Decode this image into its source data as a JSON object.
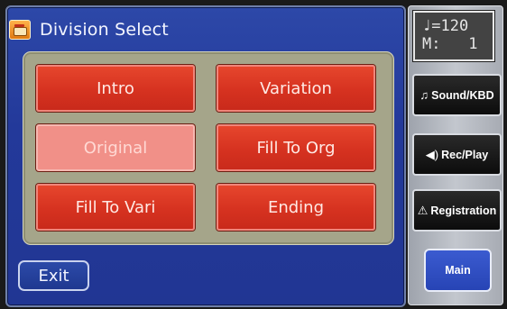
{
  "screen": {
    "title": "Division Select",
    "title_icon": "drum-icon"
  },
  "divisions": [
    {
      "label": "Intro",
      "selected": false
    },
    {
      "label": "Variation",
      "selected": false
    },
    {
      "label": "Original",
      "selected": true
    },
    {
      "label": "Fill To Org",
      "selected": false
    },
    {
      "label": "Fill To Vari",
      "selected": false
    },
    {
      "label": "Ending",
      "selected": false
    }
  ],
  "exit_label": "Exit",
  "tempo": {
    "note_glyph": "♩",
    "line1": "=120",
    "measure_label": "M:",
    "measure_value": "1"
  },
  "side_buttons": {
    "sound": {
      "icon": "music-note-icon",
      "glyph": "♫",
      "label": "Sound/KBD"
    },
    "rec": {
      "icon": "speaker-icon",
      "glyph": "◀)",
      "label": "Rec/Play"
    },
    "registration": {
      "icon": "registration-icon",
      "glyph": "⚠",
      "label": "Registration"
    },
    "main": {
      "label": "Main"
    }
  },
  "colors": {
    "panel_blue": "#23399a",
    "button_red": "#d63220",
    "selected_pink": "#f19088",
    "field_olive": "#a5a58a"
  }
}
